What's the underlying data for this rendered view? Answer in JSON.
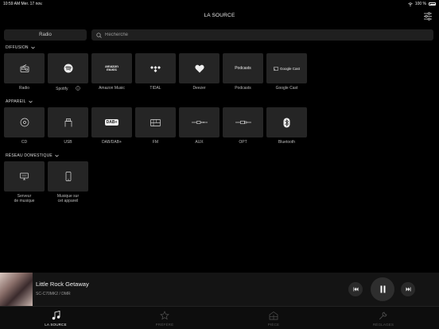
{
  "status_bar": {
    "time_date": "10:59 AM  Mer. 17 nov.",
    "battery": "100 %"
  },
  "header": {
    "title": "LA SOURCE",
    "filter_icon": "filter-sliders-icon"
  },
  "radio_button": {
    "label": "Radio"
  },
  "search": {
    "placeholder": "Recherche"
  },
  "sections": {
    "diffusion": {
      "label": "DIFFUSION",
      "items": [
        {
          "label": "Radio",
          "icon": "radio-icon"
        },
        {
          "label": "Spotify",
          "icon": "spotify-icon",
          "logo": ""
        },
        {
          "label": "Amazon Music",
          "icon": "amazon-music-logo",
          "logo": "amazon music"
        },
        {
          "label": "TIDAL",
          "icon": "tidal-icon"
        },
        {
          "label": "Deezer",
          "icon": "deezer-heart-icon"
        },
        {
          "label": "Podcasts",
          "icon": "podcasts-logo",
          "logo": "Podcasts"
        },
        {
          "label": "Google Cast",
          "icon": "google-cast-logo",
          "logo": "Google Cast"
        }
      ]
    },
    "appareil": {
      "label": "APPAREIL",
      "items": [
        {
          "label": "CD",
          "icon": "cd-icon"
        },
        {
          "label": "USB",
          "icon": "usb-icon"
        },
        {
          "label": "DAB/DAB+",
          "icon": "dab-icon",
          "logo": "DAB+"
        },
        {
          "label": "FM",
          "icon": "fm-icon"
        },
        {
          "label": "AUX",
          "icon": "aux-cable-icon"
        },
        {
          "label": "OPT",
          "icon": "optical-cable-icon"
        },
        {
          "label": "Bluetooth",
          "icon": "bluetooth-icon"
        }
      ]
    },
    "reseau": {
      "label": "RÉSEAU DOMESTIQUE",
      "items": [
        {
          "label": "Serveur de musique",
          "line1": "Serveur",
          "line2": "de musique",
          "icon": "music-server-icon"
        },
        {
          "label": "Musique sur cet appareil",
          "line1": "Musique sur",
          "line2": "cet appareil",
          "icon": "phone-icon"
        }
      ]
    }
  },
  "player": {
    "track": "Little Rock Getaway",
    "device": "SC-C70MK2 / DMR",
    "album_art": "album-art"
  },
  "tabs": [
    {
      "label": "LA SOURCE",
      "icon": "music-note-icon",
      "active": true
    },
    {
      "label": "PRÉFÉRÉ",
      "icon": "star-icon",
      "active": false
    },
    {
      "label": "PIÈCE",
      "icon": "room-icon",
      "active": false
    },
    {
      "label": "RÉGLAGES",
      "icon": "wrench-icon",
      "active": false
    }
  ]
}
